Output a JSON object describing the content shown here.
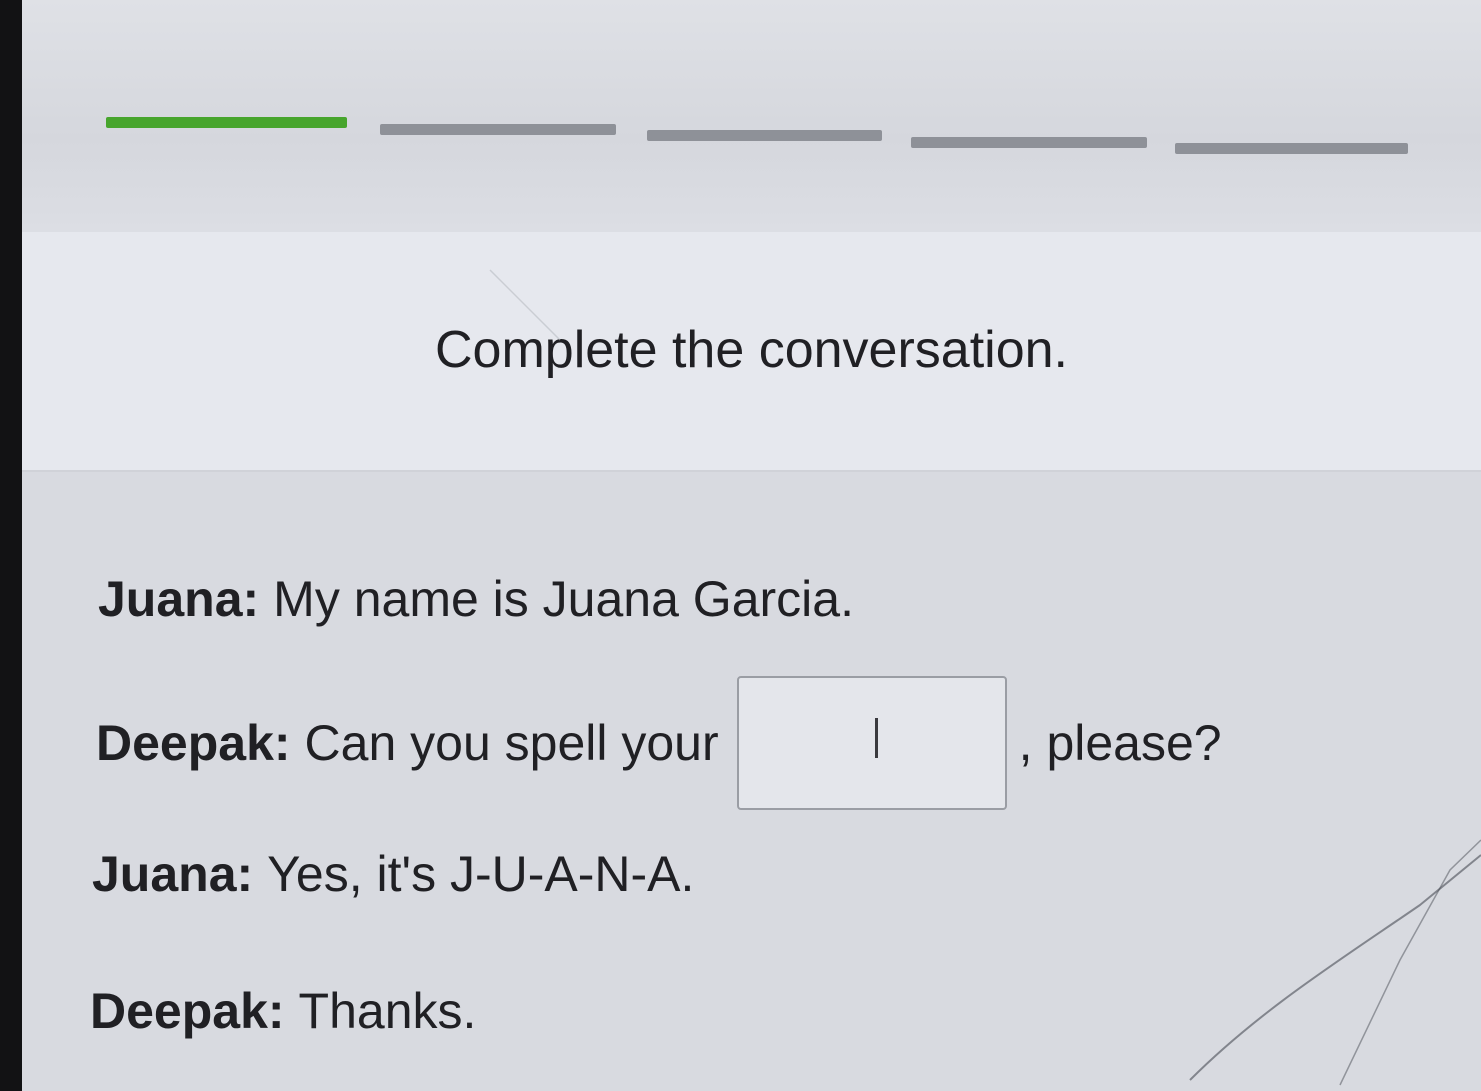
{
  "progress": {
    "total_steps": 5,
    "completed_steps": 1,
    "colors": {
      "done": "#47a52d",
      "pending": "#8e9198"
    }
  },
  "prompt": "Complete the conversation.",
  "dialogue": [
    {
      "speaker": "Juana:",
      "text": "My name is Juana Garcia."
    },
    {
      "speaker": "Deepak:",
      "before": "Can you spell your",
      "after": ", please?",
      "answer_value": ""
    },
    {
      "speaker": "Juana:",
      "text": "Yes, it's J-U-A-N-A."
    },
    {
      "speaker": "Deepak:",
      "text": "Thanks."
    }
  ]
}
